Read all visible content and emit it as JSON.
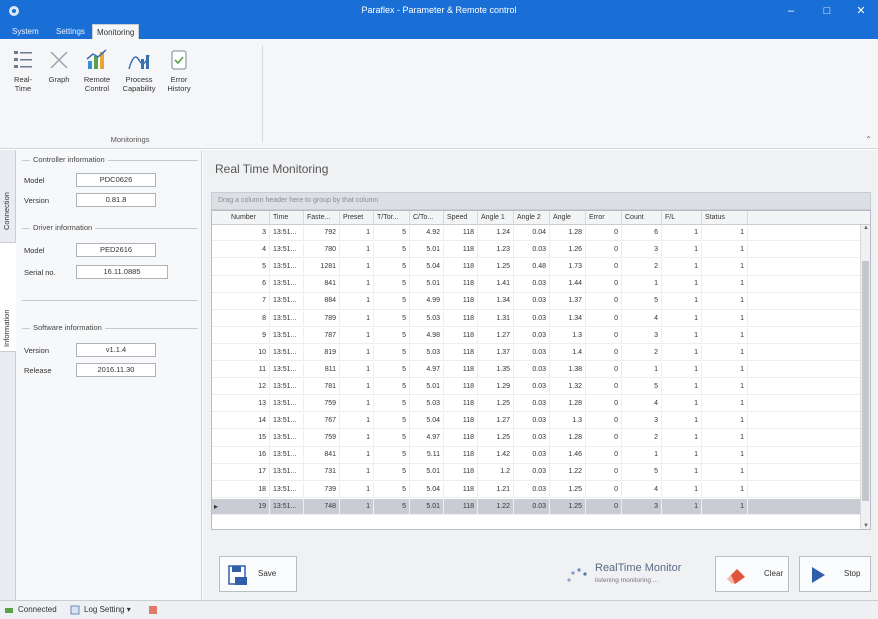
{
  "window": {
    "title": "Paraflex - Parameter & Remote control",
    "minimize": "–",
    "maximize": "□",
    "close": "✕"
  },
  "tabs": [
    {
      "label": "System"
    },
    {
      "label": "Settings"
    },
    {
      "label": "Monitoring",
      "active": true
    }
  ],
  "ribbon": {
    "buttons": [
      {
        "label": "Real-Time",
        "icon": "list-icon"
      },
      {
        "label": "Graph",
        "icon": "graph-icon"
      },
      {
        "label": "Remote Control",
        "icon": "remote-control-icon"
      },
      {
        "label": "Process Capability",
        "icon": "process-capability-icon"
      },
      {
        "label": "Error History",
        "icon": "error-history-icon"
      }
    ],
    "group_label": "Monitorings",
    "collapse": "⌃"
  },
  "sidetabs": {
    "connection": "Connection",
    "information": "Information"
  },
  "info": {
    "controller": {
      "title": "Controller information",
      "model_label": "Model",
      "model": "PDC0626",
      "version_label": "Version",
      "version": "0.81.8"
    },
    "driver": {
      "title": "Driver information",
      "model_label": "Model",
      "model": "PED2616",
      "serial_label": "Serial no.",
      "serial": "16.11.0885"
    },
    "software": {
      "title": "Software information",
      "version_label": "Version",
      "version": "v1.1.4",
      "release_label": "Release",
      "release": "2016.11.30"
    }
  },
  "main": {
    "heading": "Real Time Monitoring",
    "groupbar": "Drag a column header here to group by that column"
  },
  "grid": {
    "columns": [
      "Number",
      "Time",
      "Faste...",
      "Preset",
      "T/Tor...",
      "C/To...",
      "Speed",
      "Angle 1",
      "Angle 2",
      "Angle",
      "Error",
      "Count",
      "F/L",
      "Status"
    ],
    "rows": [
      [
        "3",
        "13:51...",
        "792",
        "1",
        "5",
        "4.92",
        "118",
        "1.24",
        "0.04",
        "1.28",
        "0",
        "6",
        "1",
        "1"
      ],
      [
        "4",
        "13:51...",
        "780",
        "1",
        "5",
        "5.01",
        "118",
        "1.23",
        "0.03",
        "1.26",
        "0",
        "3",
        "1",
        "1"
      ],
      [
        "5",
        "13:51...",
        "1281",
        "1",
        "5",
        "5.04",
        "118",
        "1.25",
        "0.48",
        "1.73",
        "0",
        "2",
        "1",
        "1"
      ],
      [
        "6",
        "13:51...",
        "841",
        "1",
        "5",
        "5.01",
        "118",
        "1.41",
        "0.03",
        "1.44",
        "0",
        "1",
        "1",
        "1"
      ],
      [
        "7",
        "13:51...",
        "884",
        "1",
        "5",
        "4.99",
        "118",
        "1.34",
        "0.03",
        "1.37",
        "0",
        "5",
        "1",
        "1"
      ],
      [
        "8",
        "13:51...",
        "789",
        "1",
        "5",
        "5.03",
        "118",
        "1.31",
        "0.03",
        "1.34",
        "0",
        "4",
        "1",
        "1"
      ],
      [
        "9",
        "13:51...",
        "787",
        "1",
        "5",
        "4.98",
        "118",
        "1.27",
        "0.03",
        "1.3",
        "0",
        "3",
        "1",
        "1"
      ],
      [
        "10",
        "13:51...",
        "819",
        "1",
        "5",
        "5.03",
        "118",
        "1.37",
        "0.03",
        "1.4",
        "0",
        "2",
        "1",
        "1"
      ],
      [
        "11",
        "13:51...",
        "811",
        "1",
        "5",
        "4.97",
        "118",
        "1.35",
        "0.03",
        "1.38",
        "0",
        "1",
        "1",
        "1"
      ],
      [
        "12",
        "13:51...",
        "781",
        "1",
        "5",
        "5.01",
        "118",
        "1.29",
        "0.03",
        "1.32",
        "0",
        "5",
        "1",
        "1"
      ],
      [
        "13",
        "13:51...",
        "759",
        "1",
        "5",
        "5.03",
        "118",
        "1.25",
        "0.03",
        "1.28",
        "0",
        "4",
        "1",
        "1"
      ],
      [
        "14",
        "13:51...",
        "767",
        "1",
        "5",
        "5.04",
        "118",
        "1.27",
        "0.03",
        "1.3",
        "0",
        "3",
        "1",
        "1"
      ],
      [
        "15",
        "13:51...",
        "759",
        "1",
        "5",
        "4.97",
        "118",
        "1.25",
        "0.03",
        "1.28",
        "0",
        "2",
        "1",
        "1"
      ],
      [
        "16",
        "13:51...",
        "841",
        "1",
        "5",
        "5.11",
        "118",
        "1.42",
        "0.03",
        "1.46",
        "0",
        "1",
        "1",
        "1"
      ],
      [
        "17",
        "13:51...",
        "731",
        "1",
        "5",
        "5.01",
        "118",
        "1.2",
        "0.03",
        "1.22",
        "0",
        "5",
        "1",
        "1"
      ],
      [
        "18",
        "13:51...",
        "739",
        "1",
        "5",
        "5.04",
        "118",
        "1.21",
        "0.03",
        "1.25",
        "0",
        "4",
        "1",
        "1"
      ],
      [
        "19",
        "13:51...",
        "748",
        "1",
        "5",
        "5.01",
        "118",
        "1.22",
        "0.03",
        "1.25",
        "0",
        "3",
        "1",
        "1"
      ]
    ],
    "current_row_marker": "▸"
  },
  "actions": {
    "save": "Save",
    "clear": "Clear",
    "stop": "Stop",
    "monitor_title": "RealTime Monitor",
    "monitor_status": "listening monitoring ..."
  },
  "status": {
    "connected": "Connected",
    "log": "Log Setting ▾"
  },
  "colors": {
    "titlebar": "#1a6fd6",
    "stop_accent": "#2f5fa8",
    "clear_accent": "#e0533d"
  }
}
